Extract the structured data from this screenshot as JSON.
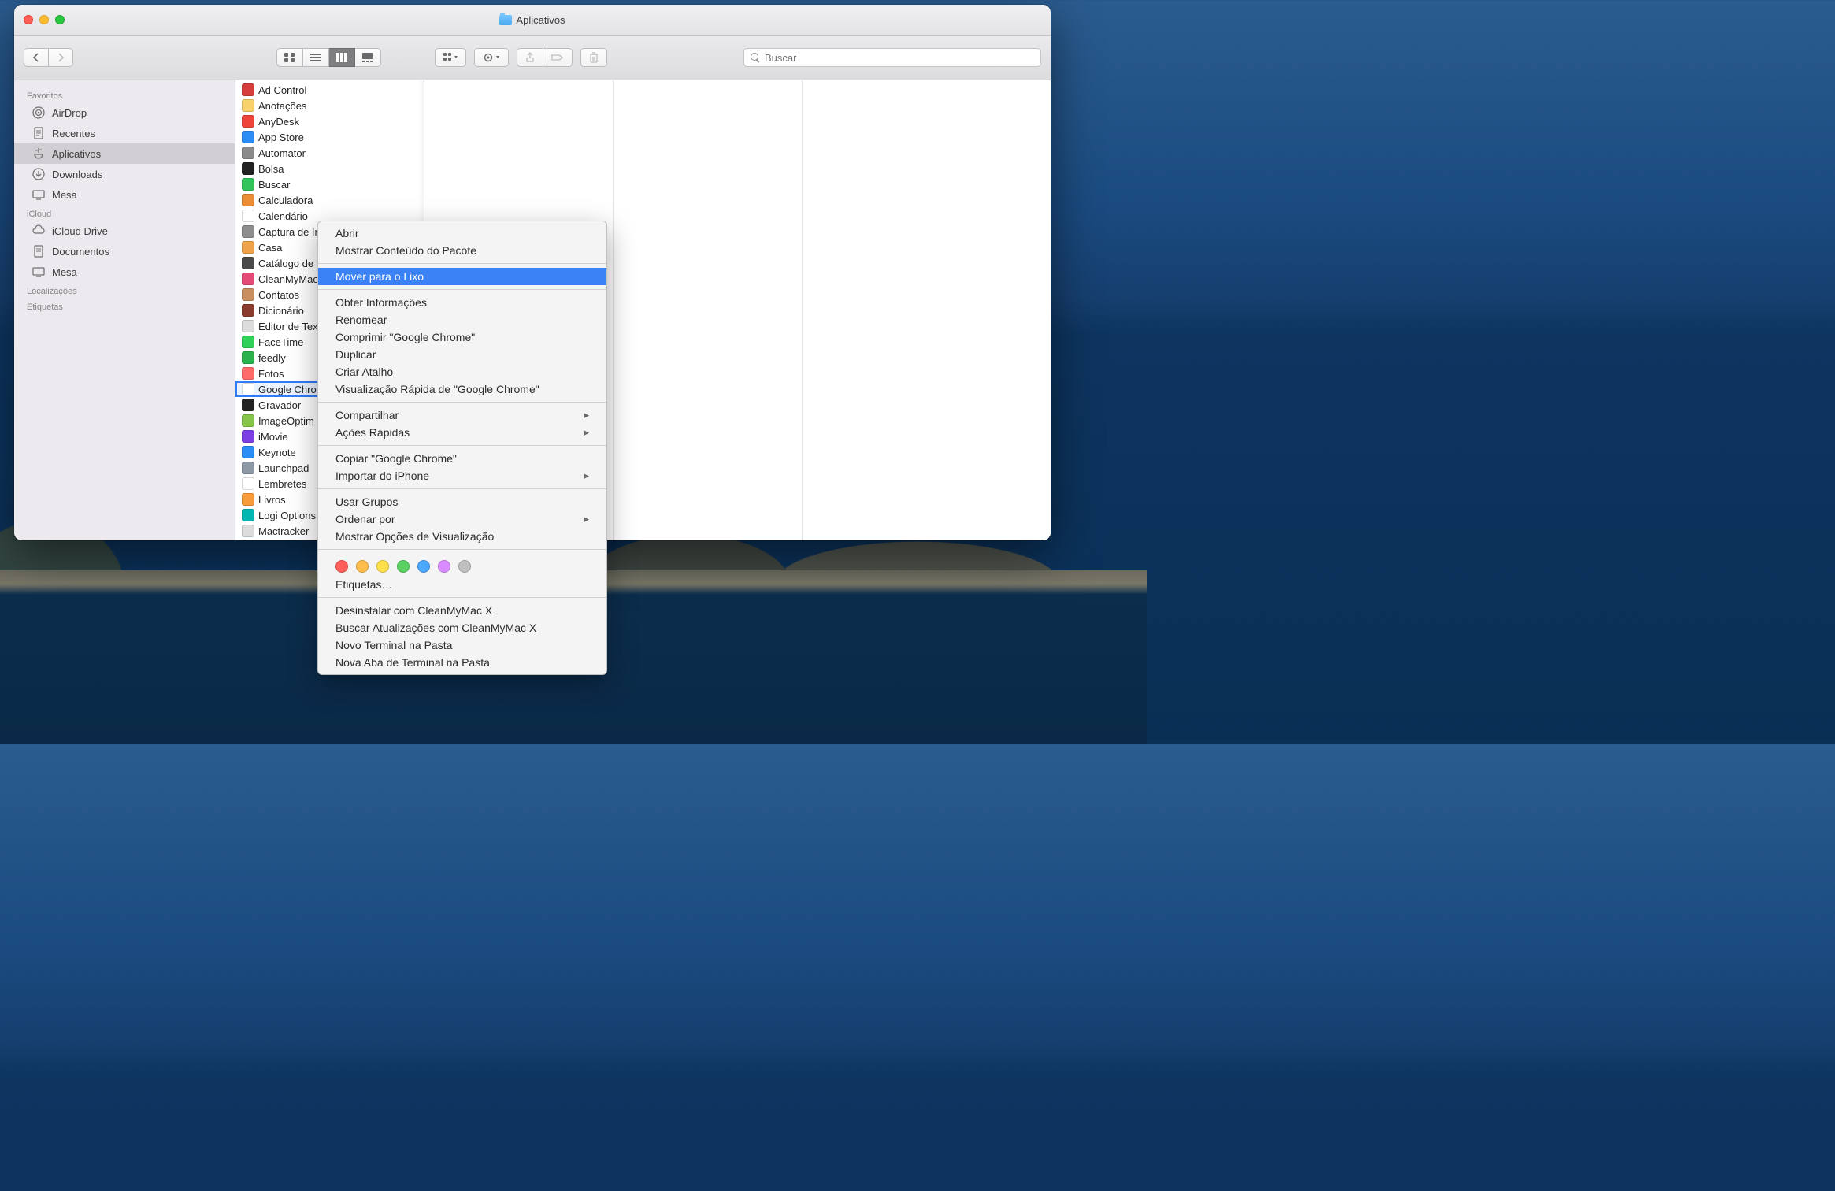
{
  "window": {
    "title": "Aplicativos"
  },
  "search": {
    "placeholder": "Buscar"
  },
  "sidebar": {
    "sections": {
      "favorites": "Favoritos",
      "icloud": "iCloud",
      "locations": "Localizações",
      "tags": "Etiquetas"
    },
    "fav": [
      {
        "label": "AirDrop"
      },
      {
        "label": "Recentes"
      },
      {
        "label": "Aplicativos"
      },
      {
        "label": "Downloads"
      },
      {
        "label": "Mesa"
      }
    ],
    "icloud": [
      {
        "label": "iCloud Drive"
      },
      {
        "label": "Documentos"
      },
      {
        "label": "Mesa"
      }
    ]
  },
  "apps": [
    {
      "name": "Ad Control",
      "c": "#d63d3d"
    },
    {
      "name": "Anotações",
      "c": "#f7d26a"
    },
    {
      "name": "AnyDesk",
      "c": "#ef443a"
    },
    {
      "name": "App Store",
      "c": "#2b8cf5"
    },
    {
      "name": "Automator",
      "c": "#8a8a8a"
    },
    {
      "name": "Bolsa",
      "c": "#222222"
    },
    {
      "name": "Buscar",
      "c": "#31c45a"
    },
    {
      "name": "Calculadora",
      "c": "#eb8d34"
    },
    {
      "name": "Calendário",
      "c": "#ffffff"
    },
    {
      "name": "Captura de Imagem",
      "c": "#8e8e8e"
    },
    {
      "name": "Casa",
      "c": "#f0a24a"
    },
    {
      "name": "Catálogo de Fontes",
      "c": "#4a4a4a"
    },
    {
      "name": "CleanMyMac X",
      "c": "#e44b77"
    },
    {
      "name": "Contatos",
      "c": "#c88f5f"
    },
    {
      "name": "Dicionário",
      "c": "#8b3b2e"
    },
    {
      "name": "Editor de Texto",
      "c": "#dcdcdc"
    },
    {
      "name": "FaceTime",
      "c": "#30d158"
    },
    {
      "name": "feedly",
      "c": "#2bb24c"
    },
    {
      "name": "Fotos",
      "c": "#ff6b6b"
    },
    {
      "name": "Google Chrome",
      "c": "#ffffff"
    },
    {
      "name": "Gravador",
      "c": "#222222"
    },
    {
      "name": "ImageOptim",
      "c": "#86c54a"
    },
    {
      "name": "iMovie",
      "c": "#7b3fe4"
    },
    {
      "name": "Keynote",
      "c": "#2a8cf5"
    },
    {
      "name": "Launchpad",
      "c": "#8e99a6"
    },
    {
      "name": "Lembretes",
      "c": "#ffffff"
    },
    {
      "name": "Livros",
      "c": "#f89b3a"
    },
    {
      "name": "Logi Options",
      "c": "#00b8b0"
    },
    {
      "name": "Mactracker",
      "c": "#dcdcdc"
    }
  ],
  "selected_app_index": 19,
  "context_menu": {
    "groups": [
      [
        "Abrir",
        "Mostrar Conteúdo do Pacote"
      ],
      [
        "Mover para o Lixo"
      ],
      [
        "Obter Informações",
        "Renomear",
        "Comprimir \"Google Chrome\"",
        "Duplicar",
        "Criar Atalho",
        "Visualização Rápida de \"Google Chrome\""
      ],
      [
        "Compartilhar>",
        "Ações Rápidas>"
      ],
      [
        "Copiar \"Google Chrome\"",
        "Importar do iPhone>"
      ],
      [
        "Usar Grupos",
        "Ordenar por>",
        "Mostrar Opções de Visualização"
      ]
    ],
    "tags_label": "Etiquetas…",
    "tag_colors": [
      "#ff5f5a",
      "#fdbc4b",
      "#fde04b",
      "#5ad162",
      "#4aa8ff",
      "#d98cff",
      "#c0c0c0"
    ],
    "extra": [
      "Desinstalar com CleanMyMac X",
      "Buscar Atualizações com CleanMyMac X",
      "Novo Terminal na Pasta",
      "Nova Aba de Terminal na Pasta"
    ],
    "highlighted": "Mover para o Lixo"
  }
}
